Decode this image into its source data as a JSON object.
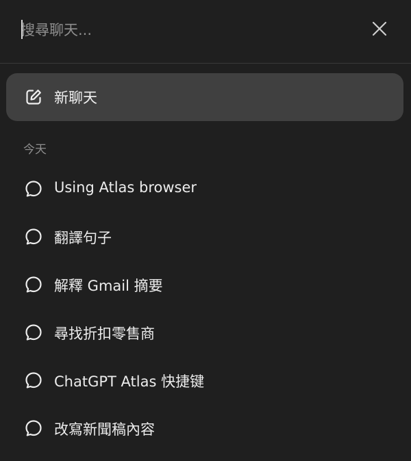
{
  "search": {
    "placeholder": "搜尋聊天..."
  },
  "new_chat": {
    "label": "新聊天"
  },
  "sections": [
    {
      "title": "今天",
      "items": [
        {
          "label": "Using Atlas browser"
        },
        {
          "label": "翻譯句子"
        },
        {
          "label": "解釋 Gmail 摘要"
        },
        {
          "label": "尋找折扣零售商"
        },
        {
          "label": "ChatGPT Atlas 快捷键"
        },
        {
          "label": "改寫新聞稿內容"
        }
      ]
    }
  ],
  "icons": {
    "close": "close-icon",
    "new_chat": "edit-icon",
    "chat": "chat-bubble-icon"
  },
  "colors": {
    "background": "#1f1f1f",
    "highlight": "#404040",
    "text": "#ececec",
    "muted": "#8e8e8e"
  }
}
